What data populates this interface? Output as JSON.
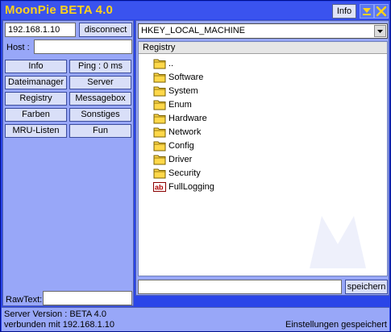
{
  "window": {
    "title": "MoonPie BETA 4.0",
    "info_label": "Info"
  },
  "connection": {
    "ip_value": "192.168.1.10",
    "disconnect_label": "disconnect",
    "host_label": "Host :",
    "host_value": ""
  },
  "nav": {
    "buttons": [
      {
        "label": "Info"
      },
      {
        "label": "Ping : 0 ms"
      },
      {
        "label": "Dateimanager"
      },
      {
        "label": "Server"
      },
      {
        "label": "Registry"
      },
      {
        "label": "Messagebox"
      },
      {
        "label": "Farben"
      },
      {
        "label": "Sonstiges"
      },
      {
        "label": "MRU-Listen"
      },
      {
        "label": "Fun"
      }
    ]
  },
  "rawtext": {
    "label": "RawText:",
    "value": ""
  },
  "registry": {
    "hive_selected": "HKEY_LOCAL_MACHINE",
    "column_header": "Registry",
    "items": [
      {
        "label": "..",
        "icon": "folder-icon"
      },
      {
        "label": "Software",
        "icon": "folder-icon"
      },
      {
        "label": "System",
        "icon": "folder-icon"
      },
      {
        "label": "Enum",
        "icon": "folder-icon"
      },
      {
        "label": "Hardware",
        "icon": "folder-icon"
      },
      {
        "label": "Network",
        "icon": "folder-icon"
      },
      {
        "label": "Config",
        "icon": "folder-icon"
      },
      {
        "label": "Driver",
        "icon": "folder-icon"
      },
      {
        "label": "Security",
        "icon": "folder-icon"
      },
      {
        "label": "FullLogging",
        "icon": "string-value-icon"
      }
    ],
    "input_value": "",
    "save_label": "speichern"
  },
  "status": {
    "server_version": "Server Version : BETA 4.0",
    "connected_to": "verbunden mit 192.168.1.10",
    "right_message": "Einstellungen gespeichert"
  },
  "colors": {
    "title_text": "#ffd21a",
    "window_bg": "#2a45e8",
    "panel_bg": "#98a7f8",
    "folder": "#ffd84a"
  }
}
